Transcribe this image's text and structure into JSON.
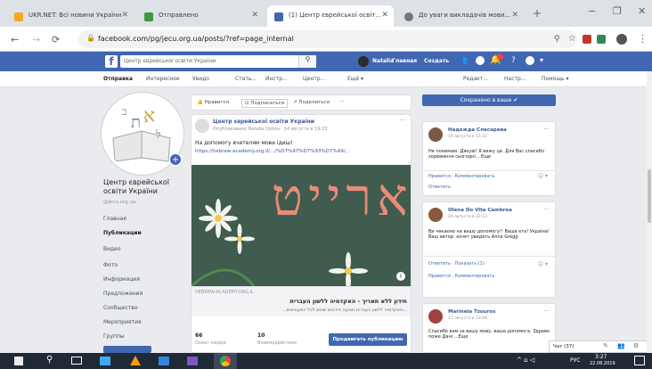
{
  "browser": {
    "tabs": [
      {
        "title": "UKR.NET: Всі новини України",
        "close": "✕"
      },
      {
        "title": "Отправлено",
        "close": "✕"
      },
      {
        "title": "(1) Центр єврейської освіт...",
        "close": "✕"
      },
      {
        "title": "До уваги викладачів мови...",
        "close": "✕"
      }
    ],
    "new_tab": "+",
    "url": "facebook.com/pg/jecu.org.ua/posts/?ref=page_internal",
    "window_controls": {
      "minimize": "−",
      "maximize": "❐",
      "close": "✕"
    }
  },
  "fb": {
    "logo": "f",
    "search_placeholder": "Центр єврейської освіти України",
    "user": "Natalia",
    "home": "Главная",
    "create": "Создать"
  },
  "page_tabs": {
    "left": [
      "Отправка",
      "Интересное",
      "Увидо",
      "Стать...",
      "Инстр...",
      "Центр...",
      "Ещё ▾"
    ],
    "right": [
      "Редакт...",
      "Настр...",
      "Помощь ▾"
    ]
  },
  "page": {
    "name": "Центр єврейської освіти України",
    "handle": "@jecu.org.ua",
    "nav": [
      "Главная",
      "Публикации",
      "Видео",
      "Фото",
      "Информация",
      "Предложения",
      "Сообщество",
      "Мероприятия",
      "Группы"
    ],
    "nav_active_index": 1
  },
  "post": {
    "actions": [
      "Нравится",
      "Подписаться",
      "Поделиться"
    ],
    "more": "···",
    "author": "Центр єврейської освіти України",
    "meta": "Опубликовано Natalia Dolina · 14 августа в 19:23",
    "text": "На допомогу вчителям мови ідиш!",
    "link_text": "https://hebrew-academy.org.il/.../%D7%97%D7%93%D7%A9/...",
    "image_letters": "דור ארייט",
    "preview_source": "HEBREW-ACADEMY.ORG.IL",
    "preview_title": "חידון ללא תאריך - האקדמיה ללשון העברית",
    "preview_desc": "...האקדמיה ללשון העברית מציעה חידונים שונים לכל המעוניינים...",
    "reach_count": "66",
    "reach_label": "Охват людей",
    "engage_count": "10",
    "engage_label": "Взаимодействия",
    "boost_button": "Продвигать публикацию"
  },
  "right": {
    "top_button": "Сохранено в ваше ✔",
    "comments": [
      {
        "name": "Надежда Слесарева",
        "time": "14 августа в 15:32",
        "text": "Не понимаю. Дякую! Я вижу це. Для Вас спасибо зорювання сьогодні... Еще",
        "actions": "Нравится · Комментировать",
        "sub": "Ответить"
      },
      {
        "name": "Olena Do Vita Cambrea",
        "time": "20 августа в 22:13",
        "text": "Ви чекаємо на вашу допомогу!! Ваша ета! Україна! Ваш автор: хочет увидеть Anna Gregg",
        "actions": "Ответить · Показать (1)",
        "sub": "Нравится · Комментировать"
      },
      {
        "name": "Marinela Tzouros",
        "time": "11 августа в 13:08",
        "text": "Спасибо вам за вашу мову, ваша допомога. Здраво поже Дані ...Еще",
        "actions": "",
        "sub": ""
      }
    ],
    "chat": "Чат (37)"
  },
  "taskbar": {
    "lang": "РУС",
    "time": "3:27",
    "date": "22.08.2019"
  }
}
